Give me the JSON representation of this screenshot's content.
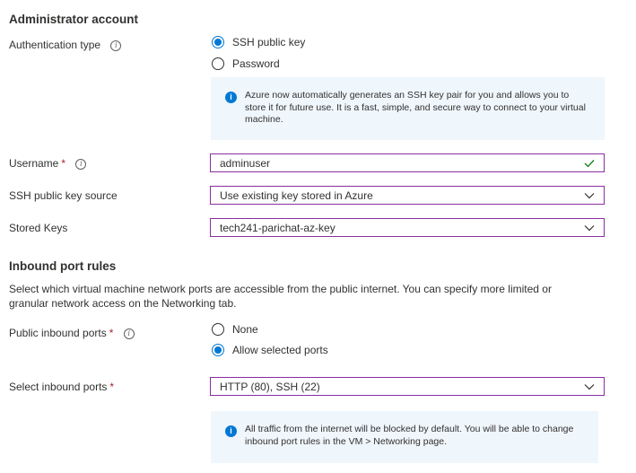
{
  "admin": {
    "heading": "Administrator account",
    "auth_label": "Authentication type",
    "auth_options": [
      "SSH public key",
      "Password"
    ],
    "auth_selected": "SSH public key",
    "info_text": "Azure now automatically generates an SSH key pair for you and allows you to store it for future use. It is a fast, simple, and secure way to connect to your virtual machine.",
    "username_label": "Username",
    "username_value": "adminuser",
    "key_source_label": "SSH public key source",
    "key_source_value": "Use existing key stored in Azure",
    "stored_keys_label": "Stored Keys",
    "stored_keys_value": "tech241-parichat-az-key"
  },
  "inbound": {
    "heading": "Inbound port rules",
    "description": "Select which virtual machine network ports are accessible from the public internet. You can specify more limited or granular network access on the Networking tab.",
    "public_ports_label": "Public inbound ports",
    "port_options": [
      "None",
      "Allow selected ports"
    ],
    "port_selected": "Allow selected ports",
    "select_ports_label": "Select inbound ports",
    "select_ports_value": "HTTP (80), SSH (22)",
    "info_text": "All traffic from the internet will be blocked by default. You will be able to change inbound port rules in the VM > Networking page."
  },
  "common": {
    "required_mark": "*",
    "info_glyph": "i"
  },
  "colors": {
    "accent": "#0078d4",
    "field_border": "#8a2ea0",
    "info_bg": "#eff6fc",
    "success": "#107c10",
    "required": "#a4262c"
  }
}
